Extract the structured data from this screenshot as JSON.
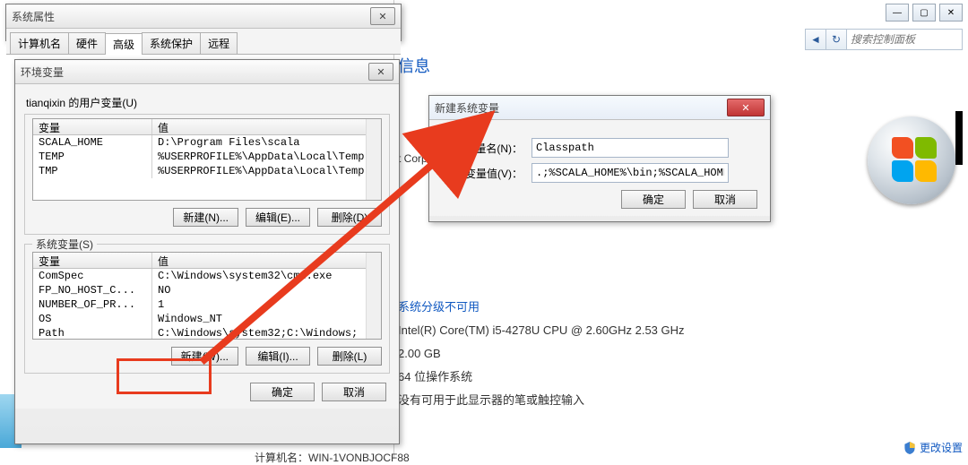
{
  "explorer": {
    "search_placeholder": "搜索控制面板",
    "banner": "信息",
    "corp": "t Corp",
    "rating_unavailable": "系统分级不可用",
    "cpu": "Intel(R) Core(TM) i5-4278U CPU @ 2.60GHz   2.53 GHz",
    "ram": "2.00 GB",
    "arch": "64 位操作系统",
    "pen": "没有可用于此显示器的笔或触控输入",
    "computer_label": "计算机名：",
    "computer_name": "WIN-1VONBJOCF88",
    "change_settings": "更改设置"
  },
  "sysprops": {
    "title": "系统属性",
    "tabs": [
      "计算机名",
      "硬件",
      "高级",
      "系统保护",
      "远程"
    ]
  },
  "envdialog": {
    "title": "环境变量",
    "user_section": "tianqixin 的用户变量(U)",
    "sys_section": "系统变量(S)",
    "col_var": "变量",
    "col_val": "值",
    "user_rows": [
      {
        "v": "SCALA_HOME",
        "d": "D:\\Program Files\\scala"
      },
      {
        "v": "TEMP",
        "d": "%USERPROFILE%\\AppData\\Local\\Temp"
      },
      {
        "v": "TMP",
        "d": "%USERPROFILE%\\AppData\\Local\\Temp"
      }
    ],
    "sys_rows": [
      {
        "v": "ComSpec",
        "d": "C:\\Windows\\system32\\cmd.exe"
      },
      {
        "v": "FP_NO_HOST_C...",
        "d": "NO"
      },
      {
        "v": "NUMBER_OF_PR...",
        "d": "1"
      },
      {
        "v": "OS",
        "d": "Windows_NT"
      },
      {
        "v": "Path",
        "d": "C:\\Windows\\system32;C:\\Windows;"
      }
    ],
    "btn_new_n": "新建(N)...",
    "btn_edit_e": "编辑(E)...",
    "btn_del_d": "删除(D)",
    "btn_new_w": "新建(W)...",
    "btn_edit_i": "编辑(I)...",
    "btn_del_l": "删除(L)",
    "ok": "确定",
    "cancel": "取消"
  },
  "newvar": {
    "title": "新建系统变量",
    "name_label": "变量名(N)：",
    "value_label": "变量值(V)：",
    "name_value": "Classpath",
    "value_value": ".;%SCALA_HOME%\\bin;%SCALA_HOME%\\lib\\",
    "ok": "确定",
    "cancel": "取消"
  }
}
